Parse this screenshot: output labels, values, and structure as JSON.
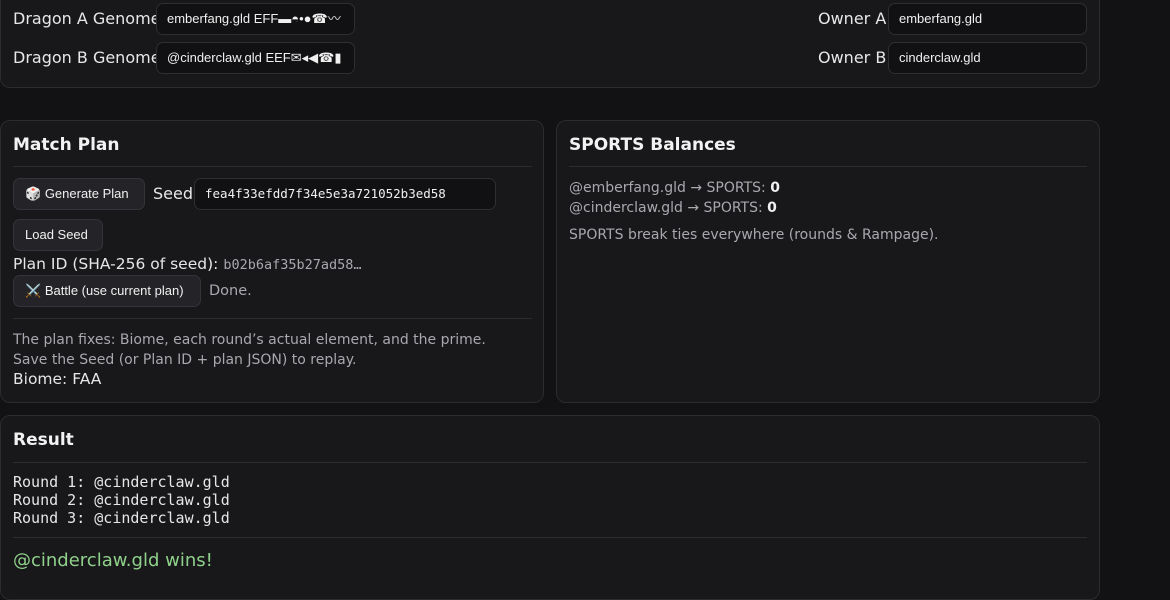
{
  "genomes": {
    "dragon_a_label": "Dragon A Genome",
    "dragon_a_value": "emberfang.gld EFF▬◓•●☎〰",
    "dragon_b_label": "Dragon B Genome",
    "dragon_b_value": "@cinderclaw.gld EEF✉◂◀☎▮",
    "owner_a_label": "Owner A",
    "owner_a_value": "emberfang.gld",
    "owner_b_label": "Owner B",
    "owner_b_value": "cinderclaw.gld"
  },
  "match_plan": {
    "title": "Match Plan",
    "generate_icon": "🎲",
    "generate_label": "Generate Plan",
    "seed_label": "Seed",
    "seed_value": "fea4f33efdd7f34e5e3a721052b3ed58",
    "load_seed_label": "Load Seed",
    "plan_id_label": "Plan ID (SHA-256 of seed):",
    "plan_id_value": "b02b6af35b27ad58…",
    "battle_icon": "⚔️",
    "battle_label": "Battle (use current plan)",
    "status": "Done.",
    "note": "The plan fixes: Biome, each round’s actual element, and the prime. Save the Seed (or Plan ID + plan JSON) to replay.",
    "biome": "Biome: FAA"
  },
  "balances": {
    "title": "SPORTS Balances",
    "rows": [
      {
        "owner": "@emberfang.gld",
        "arrow": "→ SPORTS:",
        "value": "0"
      },
      {
        "owner": "@cinderclaw.gld",
        "arrow": "→ SPORTS:",
        "value": "0"
      }
    ],
    "note": "SPORTS break ties everywhere (rounds & Rampage)."
  },
  "result": {
    "title": "Result",
    "rounds": [
      "Round 1: @cinderclaw.gld",
      "Round 2: @cinderclaw.gld",
      "Round 3: @cinderclaw.gld"
    ],
    "winner": "@cinderclaw.gld wins!",
    "winner_color": "#8fd18a"
  }
}
